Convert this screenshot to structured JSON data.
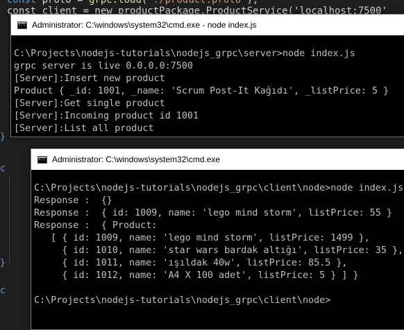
{
  "editor": {
    "line1_kw": "const",
    "line1_rest": " proto = ",
    "line1_fn": "grpc.load(",
    "line1_str": "'./product.proto'",
    "line1_end": ");",
    "line2_text": "const client = new productPackage.ProductService('localhost:7500'"
  },
  "server_window": {
    "title": "Administrator: C:\\windows\\system32\\cmd.exe - node  index.js",
    "lines": [
      "",
      "C:\\Projects\\nodejs-tutorials\\nodejs_grpc\\server>node index.js",
      "grpc server is live 0.0.0.0:7500",
      "[Server]:Insert new product",
      "Product { _id: 1001, _name: 'Scrum Post-It Kağıdı', _listPrice: 5 }",
      "[Server]:Get single product",
      "[Server]:Incoming product id 1001",
      "[Server]:List all product"
    ]
  },
  "client_window": {
    "title": "Administrator: C:\\windows\\system32\\cmd.exe",
    "lines": [
      "",
      "C:\\Projects\\nodejs-tutorials\\nodejs_grpc\\client\\node>node index.js",
      "Response :  {}",
      "Response :  { id: 1009, name: 'lego mind storm', listPrice: 55 }",
      "Response :  { Product:",
      "   [ { id: 1009, name: 'lego mind storm', listPrice: 1499 },",
      "     { id: 1010, name: 'star wars bardak altığı', listPrice: 35 },",
      "     { id: 1011, name: 'ışıldak 40w', listPrice: 85.5 },",
      "     { id: 1012, name: 'A4 X 100 adet', listPrice: 5 } ] }",
      "",
      "C:\\Projects\\nodejs-tutorials\\nodejs_grpc\\client\\node>"
    ]
  },
  "colors": {
    "console_bg": "#000000",
    "console_text": "#c0c0c0",
    "titlebar_bg": "#ffffff",
    "editor_bg": "#1e1e1e"
  },
  "icons": {
    "title_icon": "cmd-console-icon"
  }
}
